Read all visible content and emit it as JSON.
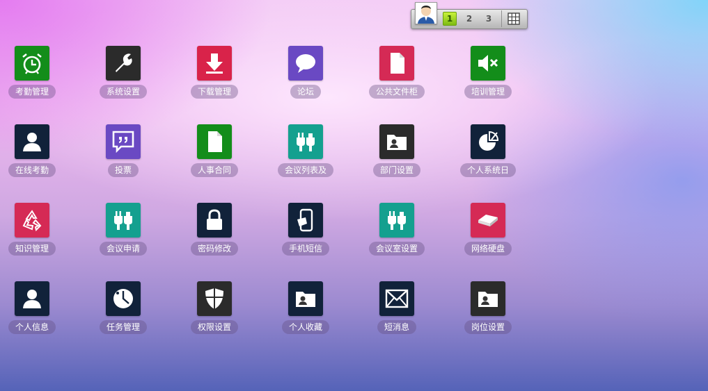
{
  "pager": {
    "pages": [
      "1",
      "2",
      "3"
    ],
    "active_index": 0
  },
  "colors": {
    "green": "#138d1a",
    "dark": "#2b2b2b",
    "red": "#d9234a",
    "purple": "#6a49c3",
    "pink": "#d52a55",
    "navy": "#11223a",
    "teal": "#14a08f"
  },
  "apps": [
    {
      "label": "考勤管理",
      "icon": "alarm-clock-icon",
      "color": "#138d1a"
    },
    {
      "label": "系统设置",
      "icon": "wrench-icon",
      "color": "#2b2b2b"
    },
    {
      "label": "下载管理",
      "icon": "download-arrow-icon",
      "color": "#d9234a"
    },
    {
      "label": "论坛",
      "icon": "speech-bubble-icon",
      "color": "#6a49c3"
    },
    {
      "label": "公共文件柜",
      "icon": "document-icon",
      "color": "#d52a55"
    },
    {
      "label": "培训管理",
      "icon": "speaker-mute-icon",
      "color": "#138d1a"
    },
    {
      "label": "在线考勤",
      "icon": "user-icon",
      "color": "#11223a"
    },
    {
      "label": "投票",
      "icon": "quote-bubble-icon",
      "color": "#6a49c3"
    },
    {
      "label": "人事合同",
      "icon": "document-icon",
      "color": "#138d1a"
    },
    {
      "label": "会议列表及",
      "icon": "plug-icon",
      "color": "#14a08f"
    },
    {
      "label": "部门设置",
      "icon": "contact-folder-icon",
      "color": "#2b2b2b"
    },
    {
      "label": "个人系统日",
      "icon": "pie-chart-icon",
      "color": "#11223a"
    },
    {
      "label": "知识管理",
      "icon": "recycle-icon",
      "color": "#d52a55"
    },
    {
      "label": "会议申请",
      "icon": "plug-icon",
      "color": "#14a08f"
    },
    {
      "label": "密码修改",
      "icon": "lock-icon",
      "color": "#11223a"
    },
    {
      "label": "手机短信",
      "icon": "phone-icon",
      "color": "#11223a"
    },
    {
      "label": "会议室设置",
      "icon": "plug-icon",
      "color": "#14a08f"
    },
    {
      "label": "网络硬盘",
      "icon": "hard-disk-icon",
      "color": "#d52a55"
    },
    {
      "label": "个人信息",
      "icon": "user-icon",
      "color": "#11223a"
    },
    {
      "label": "任务管理",
      "icon": "clock-icon",
      "color": "#11223a"
    },
    {
      "label": "权限设置",
      "icon": "shield-icon",
      "color": "#2b2b2b"
    },
    {
      "label": "个人收藏",
      "icon": "contact-folder-icon",
      "color": "#11223a"
    },
    {
      "label": "短消息",
      "icon": "envelope-icon",
      "color": "#11223a"
    },
    {
      "label": "岗位设置",
      "icon": "contact-folder-icon",
      "color": "#2b2b2b"
    }
  ]
}
